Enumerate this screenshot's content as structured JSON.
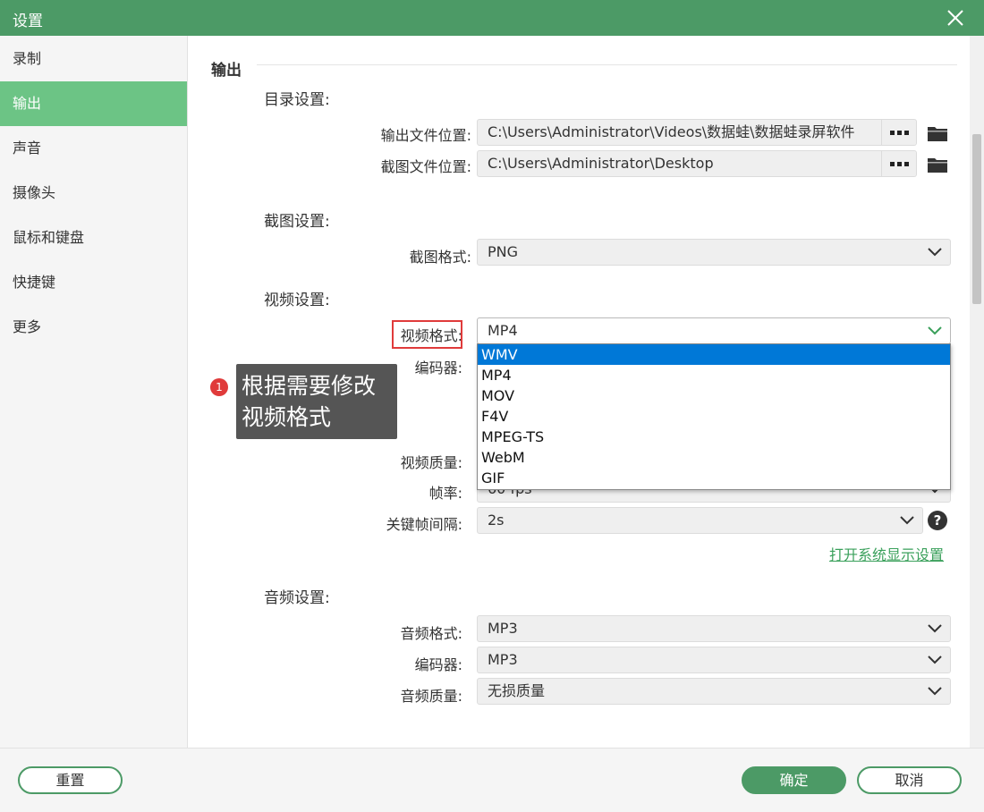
{
  "window": {
    "title": "设置"
  },
  "sidebar": {
    "items": [
      {
        "label": "录制"
      },
      {
        "label": "输出",
        "active": true
      },
      {
        "label": "声音"
      },
      {
        "label": "摄像头"
      },
      {
        "label": "鼠标和键盘"
      },
      {
        "label": "快捷键"
      },
      {
        "label": "更多"
      }
    ]
  },
  "main": {
    "section_title": "输出",
    "directory": {
      "title": "目录设置:",
      "output_label": "输出文件位置:",
      "output_path": "C:\\Users\\Administrator\\Videos\\数据蛙\\数据蛙录屏软件",
      "screenshot_label": "截图文件位置:",
      "screenshot_path": "C:\\Users\\Administrator\\Desktop"
    },
    "screenshot": {
      "title": "截图设置:",
      "format_label": "截图格式:",
      "format_value": "PNG"
    },
    "video": {
      "title": "视频设置:",
      "format_label": "视频格式:",
      "format_value": "MP4",
      "encoder_label": "编码器:",
      "quality_label": "视频质量:",
      "framerate_label": "帧率:",
      "framerate_value": "60 fps",
      "keyframe_label": "关键帧间隔:",
      "keyframe_value": "2s",
      "display_link": "打开系统显示设置",
      "help_glyph": "?"
    },
    "audio": {
      "title": "音频设置:",
      "format_label": "音频格式:",
      "format_value": "MP3",
      "encoder_label": "编码器:",
      "encoder_value": "MP3",
      "quality_label": "音频质量:",
      "quality_value": "无损质量"
    }
  },
  "dropdown": {
    "options": [
      "WMV",
      "MP4",
      "MOV",
      "F4V",
      "MPEG-TS",
      "WebM",
      "GIF"
    ],
    "highlighted": "WMV"
  },
  "annotation": {
    "badge": "1",
    "line1": "根据需要修改",
    "line2": "视频格式"
  },
  "footer": {
    "reset_label": "重置",
    "ok_label": "确定",
    "cancel_label": "取消"
  },
  "colors": {
    "titlebar": "#4c9a66",
    "sidebar_active": "#6cc485",
    "highlight_box": "#e03b3b",
    "dropdown_selected": "#0078d7",
    "link": "#3aa05b"
  }
}
